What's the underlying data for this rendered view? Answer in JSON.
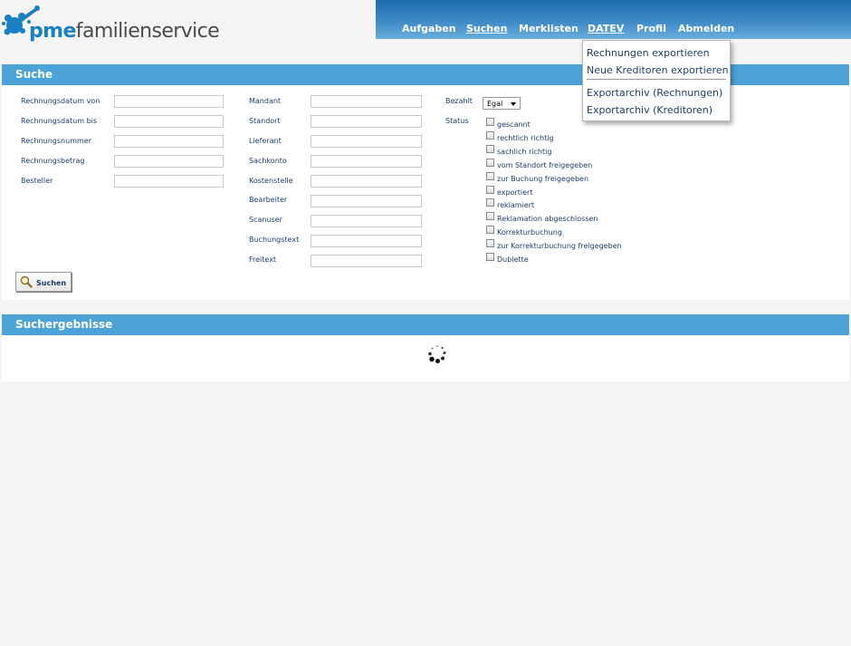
{
  "logo": {
    "brand": "pme",
    "name": "familienservice"
  },
  "nav": {
    "items": [
      {
        "label": "Aufgaben"
      },
      {
        "label": "Suchen"
      },
      {
        "label": "Merklisten"
      },
      {
        "label": "DATEV"
      },
      {
        "label": "Profil"
      },
      {
        "label": "Abmelden"
      }
    ]
  },
  "datev_menu": {
    "items": [
      {
        "label": "Rechnungen exportieren"
      },
      {
        "label": "Neue Kreditoren exportieren"
      },
      {
        "label": "Exportarchiv (Rechnungen)"
      },
      {
        "label": "Exportarchiv (Kreditoren)"
      }
    ]
  },
  "search_panel": {
    "title": "Suche",
    "col1": [
      {
        "label": "Rechnungsdatum von",
        "value": ""
      },
      {
        "label": "Rechnungsdatum bis",
        "value": ""
      },
      {
        "label": "Rechnungsnummer",
        "value": ""
      },
      {
        "label": "Rechnungsbetrag",
        "value": ""
      },
      {
        "label": "Besteller",
        "value": ""
      }
    ],
    "col2": [
      {
        "label": "Mandant",
        "value": ""
      },
      {
        "label": "Standort",
        "value": ""
      },
      {
        "label": "Lieferant",
        "value": ""
      },
      {
        "label": "Sachkonto",
        "value": ""
      },
      {
        "label": "Kostenstelle",
        "value": ""
      },
      {
        "label": "Bearbeiter",
        "value": ""
      },
      {
        "label": "Scanuser",
        "value": ""
      },
      {
        "label": "Buchungstext",
        "value": ""
      },
      {
        "label": "Freitext",
        "value": ""
      }
    ],
    "paid": {
      "label": "Bezahlt",
      "value": "Egal"
    },
    "status": {
      "label": "Status",
      "options": [
        {
          "label": "gescannt",
          "checked": false
        },
        {
          "label": "rechtlich richtig",
          "checked": false
        },
        {
          "label": "sachlich richtig",
          "checked": false
        },
        {
          "label": "vom Standort freigegeben",
          "checked": false
        },
        {
          "label": "zur Buchung freigegeben",
          "checked": false
        },
        {
          "label": "exportiert",
          "checked": false
        },
        {
          "label": "reklamiert",
          "checked": false
        },
        {
          "label": "Reklamation abgeschlossen",
          "checked": false
        },
        {
          "label": "Korrekturbuchung",
          "checked": false
        },
        {
          "label": "zur Korrekturbuchung freigegeben",
          "checked": false
        },
        {
          "label": "Dublette",
          "checked": false
        }
      ]
    },
    "button": {
      "label": "Suchen"
    }
  },
  "results_panel": {
    "title": "Suchergebnisse"
  },
  "colors": {
    "nav_blue": "#1d6aab",
    "panel_head": "#4ba3d8",
    "text": "#1e3f66",
    "background": "#f4f4f4"
  },
  "icons": [
    "logo-splash-icon",
    "magnifier-icon",
    "loading-spinner-icon",
    "chevron-down-icon"
  ]
}
